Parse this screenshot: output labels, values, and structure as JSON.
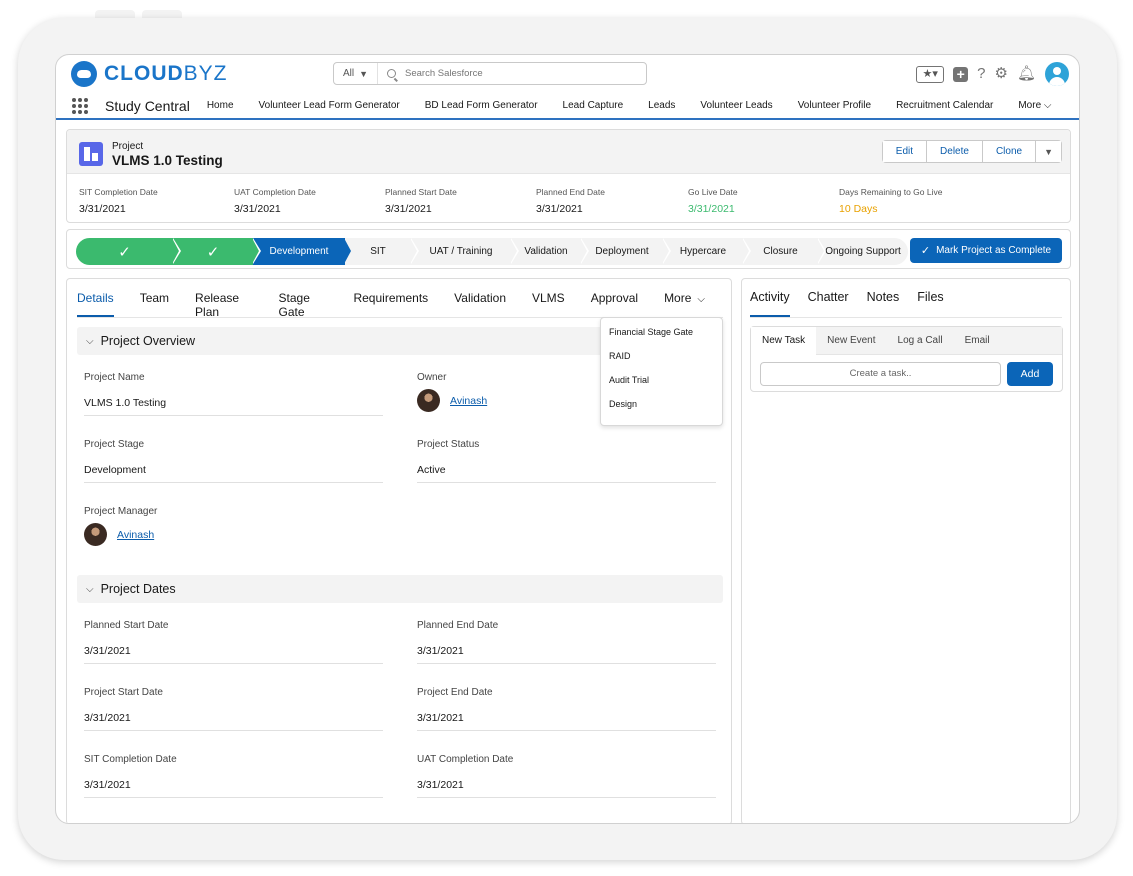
{
  "brand": {
    "logo_bold": "CLOUD",
    "logo_thin": "BYZ"
  },
  "search": {
    "scope": "All",
    "placeholder": "Search Salesforce"
  },
  "app_nav": {
    "app_name": "Study Central",
    "items": [
      "Home",
      "Volunteer Lead Form Generator",
      "BD Lead Form Generator",
      "Lead Capture",
      "Leads",
      "Volunteer Leads",
      "Volunteer Profile",
      "Recruitment Calendar"
    ],
    "more_label": "More"
  },
  "record": {
    "type": "Project",
    "name": "VLMS 1.0 Testing",
    "actions": {
      "edit": "Edit",
      "delete": "Delete",
      "clone": "Clone"
    },
    "highlights": [
      {
        "label": "SIT Completion Date",
        "value": "3/31/2021"
      },
      {
        "label": "UAT Completion Date",
        "value": "3/31/2021"
      },
      {
        "label": "Planned Start Date",
        "value": "3/31/2021"
      },
      {
        "label": "Planned End Date",
        "value": "3/31/2021"
      },
      {
        "label": "Go Live Date",
        "value": "3/31/2021"
      },
      {
        "label": "Days Remaining to Go Live",
        "value": "10 Days"
      }
    ],
    "highlight_colors": {
      "go_live": "#3bba6e",
      "days_remaining": "#e8a100"
    }
  },
  "path": {
    "stages": [
      "",
      "",
      "Development",
      "SIT",
      "UAT / Training",
      "Validation",
      "Deployment",
      "Hypercare",
      "Closure",
      "Ongoing Support"
    ],
    "mark_complete": "Mark Project as Complete",
    "colors": {
      "complete": "#3bba6e",
      "current": "#0b65b8",
      "incomplete": "#f3f3f3"
    }
  },
  "tabs": [
    "Details",
    "Team",
    "Release Plan",
    "Stage Gate",
    "Requirements",
    "Validation",
    "VLMS",
    "Approval"
  ],
  "tabs_more": "More",
  "more_menu": [
    "Financial Stage Gate",
    "RAID",
    "Audit Trial",
    "Design"
  ],
  "overview": {
    "title": "Project Overview",
    "project_name_label": "Project Name",
    "project_name": "VLMS 1.0 Testing",
    "owner_label": "Owner",
    "owner": "Avinash",
    "stage_label": "Project Stage",
    "stage": "Development",
    "status_label": "Project Status",
    "status": "Active",
    "manager_label": "Project Manager",
    "manager": "Avinash"
  },
  "dates": {
    "title": "Project Dates",
    "planned_start_label": "Planned Start Date",
    "planned_start": "3/31/2021",
    "planned_end_label": "Planned End Date",
    "planned_end": "3/31/2021",
    "start_label": "Project Start Date",
    "start": "3/31/2021",
    "end_label": "Project End Date",
    "end": "3/31/2021",
    "sit_label": "SIT Completion Date",
    "sit": "3/31/2021",
    "uat_label": "UAT Completion Date",
    "uat": "3/31/2021"
  },
  "right_tabs": [
    "Activity",
    "Chatter",
    "Notes",
    "Files"
  ],
  "activity": {
    "tabs": [
      "New Task",
      "New Event",
      "Log a Call",
      "Email"
    ],
    "task_placeholder": "Create a task..",
    "add_label": "Add"
  }
}
